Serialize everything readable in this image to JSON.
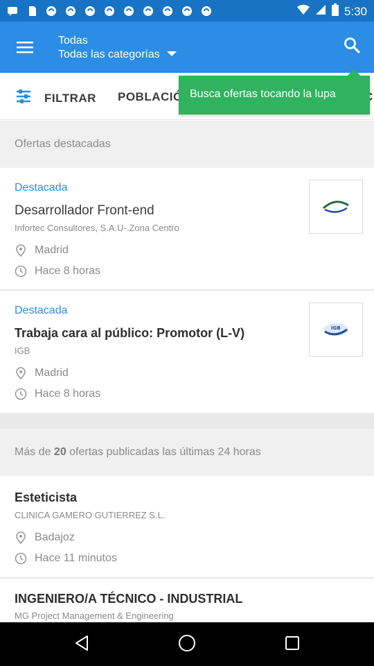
{
  "status_bar": {
    "time": "5:30"
  },
  "app_bar": {
    "title": "Todas",
    "subtitle": "Todas las categorías"
  },
  "filters": {
    "filter_label": "FILTRAR",
    "poblacion_label": "POBLACIÓ",
    "next_fragment": "C"
  },
  "tooltip": {
    "text": "Busca ofertas tocando la lupa"
  },
  "featured_header": "Ofertas destacadas",
  "featured_jobs": [
    {
      "badge": "Destacada",
      "title": "Desarrollador Front-end",
      "company": "Infortec Consultores, S.A.U-.Zona Centro",
      "location": "Madrid",
      "time": "Hace 8 horas",
      "logo_text": "INFORTEC Consultores"
    },
    {
      "badge": "Destacada",
      "title": "Trabaja cara al público: Promotor (L-V)",
      "company": "IGB",
      "location": "Madrid",
      "time": "Hace 8 horas",
      "logo_text": "IGB"
    }
  ],
  "recent_header": {
    "prefix": "Más de",
    "count": "20",
    "suffix": "ofertas publicadas las últimas 24 horas"
  },
  "recent_jobs": [
    {
      "title": "Esteticista",
      "company": "CLINICA GAMERO GUTIERREZ S.L.",
      "location": "Badajoz",
      "time": "Hace 11 minutos"
    },
    {
      "title": "INGENIERO/A TÉCNICO -  INDUSTRIAL",
      "company": "MG Project Management & Engineering"
    }
  ],
  "colors": {
    "status_bar": "#1873c4",
    "app_bar": "#2b8de6",
    "accent": "#2b8de6",
    "tooltip": "#2fb35e"
  }
}
